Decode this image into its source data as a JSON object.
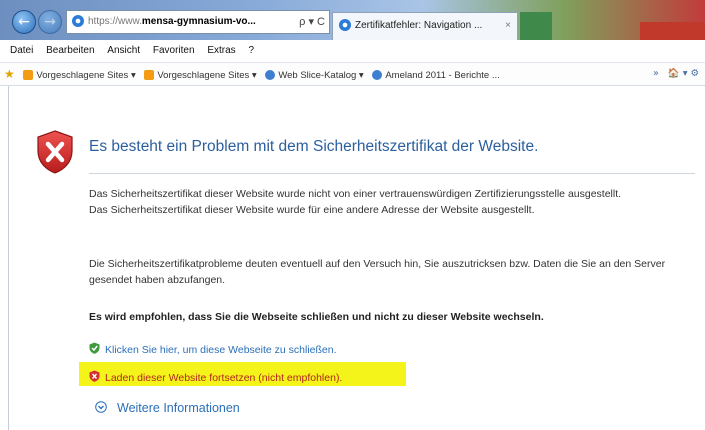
{
  "browser": {
    "address": {
      "url_prefix": "https://www.",
      "url_host": "mensa-gymnasium-vo...",
      "controls": "ρ ▾ C"
    },
    "tab": {
      "title": "Zertifikatfehler: Navigation ...",
      "close": "×"
    },
    "nav": {
      "back": "←",
      "forward": "→"
    }
  },
  "menu": [
    "Datei",
    "Bearbeiten",
    "Ansicht",
    "Favoriten",
    "Extras",
    "?"
  ],
  "favorites": {
    "items": [
      "Vorgeschlagene Sites ▾",
      "Vorgeschlagene Sites ▾",
      "Web Slice-Katalog ▾",
      "Ameland 2011 - Berichte ..."
    ],
    "more": "»",
    "tools": "🏠 ▾ ⚙"
  },
  "page": {
    "headline": "Es besteht ein Problem mit dem Sicherheitszertifikat der Website.",
    "para1": "Das Sicherheitszertifikat dieser Website wurde nicht von einer vertrauenswürdigen Zertifizierungsstelle ausgestellt.",
    "para1b": "Das Sicherheitszertifikat dieser Website wurde für eine andere Adresse der Website ausgestellt.",
    "para2": "Die Sicherheitszertifikatprobleme deuten eventuell auf den Versuch hin, Sie auszutricksen bzw. Daten die Sie an den Server gesendet haben abzufangen.",
    "recommendation": "Es wird empfohlen, dass Sie die Webseite schließen und nicht zu dieser Website wechseln.",
    "close_link": "Klicken Sie hier, um diese Webseite zu schließen.",
    "continue_link": "Laden dieser Website fortsetzen (nicht empfohlen).",
    "more_info": "Weitere Informationen"
  },
  "colors": {
    "headline": "#2b5f9e",
    "link": "#2b6fb8",
    "highlight": "#f4f41a",
    "shield_red": "#c62828"
  }
}
